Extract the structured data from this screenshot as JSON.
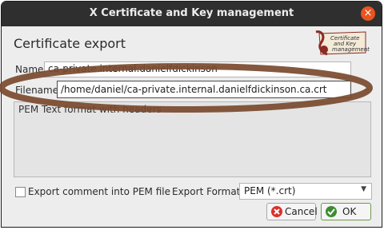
{
  "window": {
    "title": "X Certificate and Key management",
    "close_symbol": "×"
  },
  "dialog": {
    "heading": "Certificate export",
    "logo": {
      "lines": [
        "Certificate",
        "and Key",
        "management"
      ]
    },
    "name_label": "Name",
    "name_value": "ca-private.internal.danielfdickinson",
    "filename_label": "Filename",
    "filename_value": "/home/daniel/ca-private.internal.danielfdickinson.ca.crt",
    "browse_label": "...",
    "description": "PEM Text format with headers",
    "export_comment_label": "Export comment into PEM file",
    "export_format_label": "Export Format",
    "export_format_value": "PEM (*.crt)",
    "cancel_label": "Cancel",
    "ok_label": "OK"
  },
  "annotation": {
    "color": "#7a4a2e"
  },
  "colors": {
    "titlebar": "#2f2f2f",
    "close": "#e9541f",
    "dialog_bg": "#ededed"
  }
}
